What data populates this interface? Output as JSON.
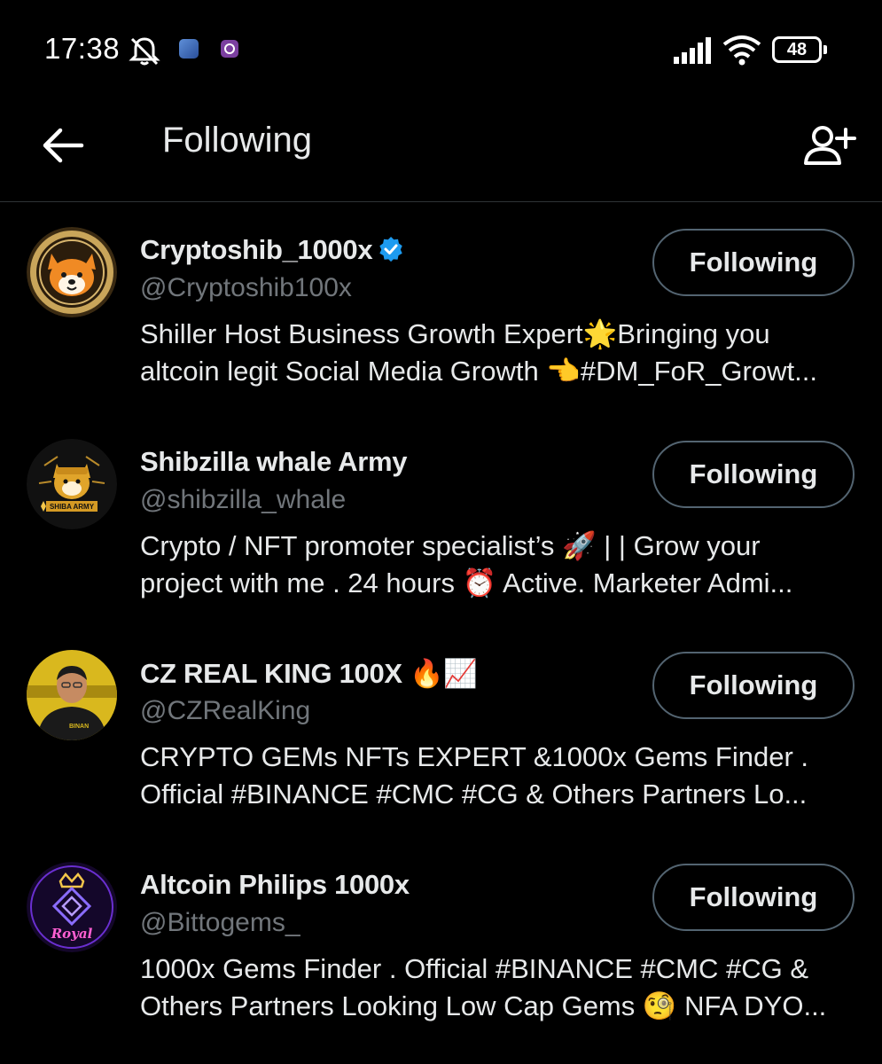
{
  "status_bar": {
    "time": "17:38",
    "battery_level": "48"
  },
  "header": {
    "title": "Following"
  },
  "accounts": [
    {
      "name": "Cryptoshib_1000x",
      "verified": true,
      "handle": "@Cryptoshib100x",
      "bio_line1": "Shiller Host Business Growth Expert🌟Bringing you",
      "bio_line2": "altcoin legit Social Media Growth 👈#DM_FoR_Growt...",
      "button_label": "Following",
      "avatar_icon": "shiba-coin-avatar"
    },
    {
      "name": "Shibzilla whale Army",
      "verified": false,
      "handle": "@shibzilla_whale",
      "bio_line1": "Crypto / NFT promoter specialist’s 🚀 | | Grow your",
      "bio_line2": "project with me . 24 hours ⏰ Active. Marketer Admi...",
      "button_label": "Following",
      "avatar_icon": "shiba-army-avatar"
    },
    {
      "name": "CZ REAL KING 100X 🔥📈",
      "verified": false,
      "handle": "@CZRealKing",
      "bio_line1": "CRYPTO GEMs  NFTs EXPERT &1000x Gems Finder .",
      "bio_line2": "Official #BINANCE #CMC #CG & Others Partners Lo...",
      "button_label": "Following",
      "avatar_icon": "person-photo-avatar"
    },
    {
      "name": "Altcoin Philips 1000x",
      "verified": false,
      "handle": "@Bittogems_",
      "bio_line1": "1000x Gems Finder . Official #BINANCE #CMC #CG &",
      "bio_line2": "Others Partners Looking Low Cap Gems 🧐 NFA DYO...",
      "button_label": "Following",
      "avatar_icon": "royal-neon-avatar"
    }
  ],
  "colors": {
    "background": "#000000",
    "primary_text": "#e7e9ea",
    "secondary_text": "#71767b",
    "border": "#2f3336",
    "verified_badge": "#1d9bf0"
  }
}
